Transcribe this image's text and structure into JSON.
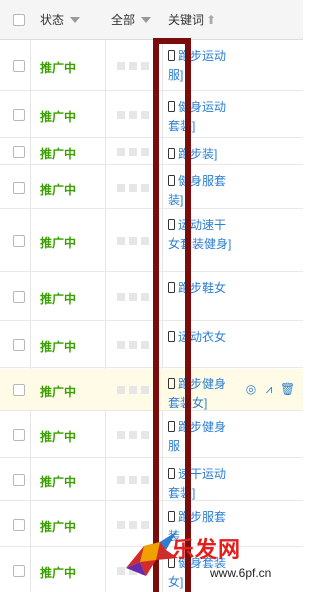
{
  "header": {
    "status_label": "状态",
    "filter_label": "全部",
    "keyword_label": "关键词"
  },
  "rows": [
    {
      "status": "推广中",
      "kw": "跑步运动服]",
      "highlight": false
    },
    {
      "status": "推广中",
      "kw": "健身运动套装]",
      "highlight": false
    },
    {
      "status": "推广中",
      "kw": "跑步装]",
      "highlight": false
    },
    {
      "status": "推广中",
      "kw": "健身服套装]",
      "highlight": false
    },
    {
      "status": "推广中",
      "kw": "运动速干女套装健身]",
      "highlight": false
    },
    {
      "status": "推广中",
      "kw": "跑步鞋女",
      "highlight": false
    },
    {
      "status": "推广中",
      "kw": "运动衣女",
      "highlight": false
    },
    {
      "status": "推广中",
      "kw": "跑步健身套装女]",
      "highlight": true
    },
    {
      "status": "推广中",
      "kw": "跑步健身服",
      "highlight": false
    },
    {
      "status": "推广中",
      "kw": "速干运动套装]",
      "highlight": false
    },
    {
      "status": "推广中",
      "kw": "跑步服套装",
      "highlight": false
    },
    {
      "status": "推广中",
      "kw": "健身套装 女]",
      "highlight": false
    }
  ],
  "actions": {
    "icons": [
      "target-icon",
      "chart-icon",
      "delete-icon"
    ]
  },
  "watermark": {
    "logo_text": "乐发网",
    "url_text": "www.6pf.cn"
  },
  "colors": {
    "status_green": "#3aa000",
    "link_blue": "#2a7fd4",
    "frame_red": "#7a0c0c",
    "highlight_bg": "#fffbe6"
  }
}
